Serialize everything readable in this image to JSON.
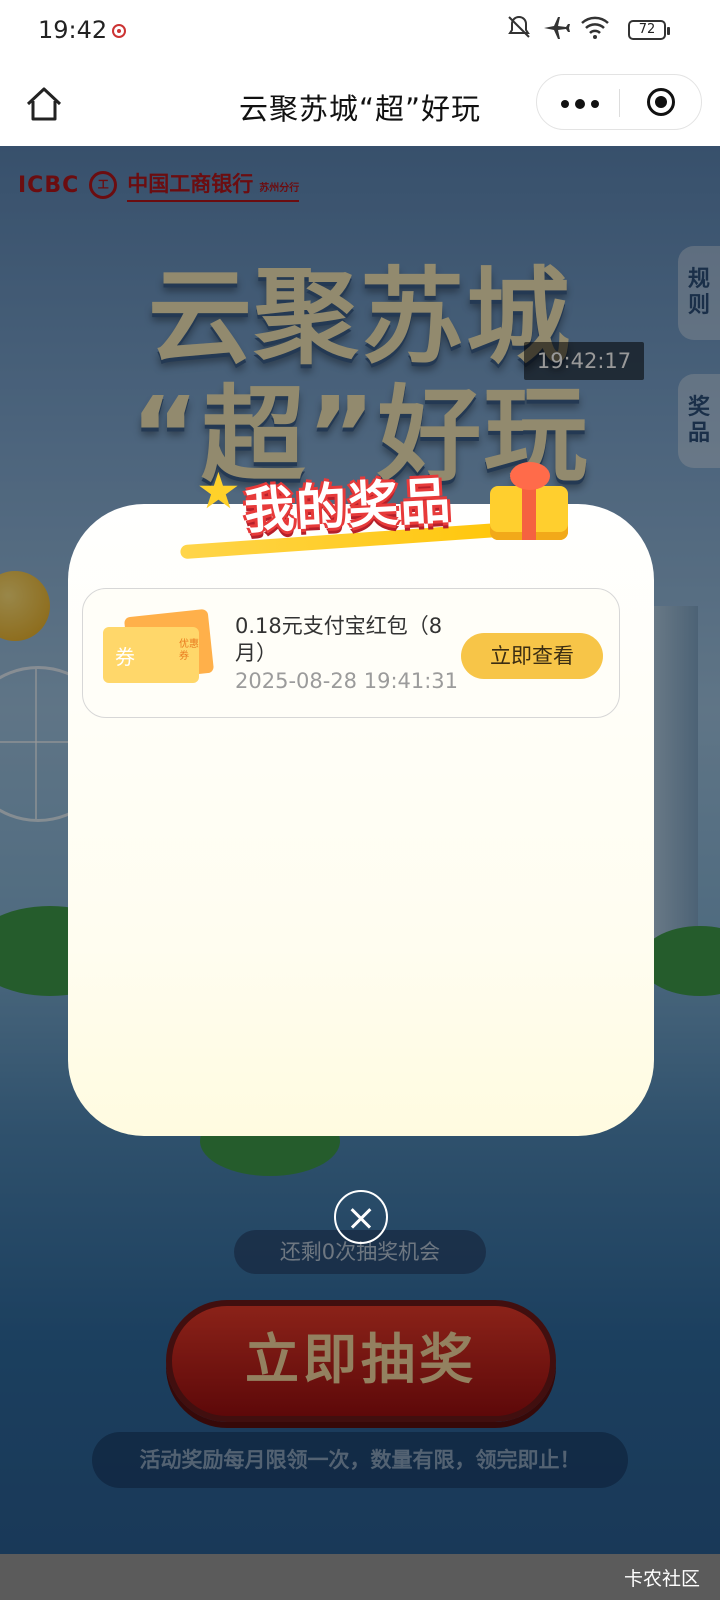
{
  "status_bar": {
    "time": "19:42",
    "battery": "72",
    "icons": [
      "recording-icon",
      "bell-off-icon",
      "airplane-icon",
      "wifi-icon",
      "battery-icon"
    ]
  },
  "nav": {
    "title": "云聚苏城“超”好玩"
  },
  "banner": {
    "bank_icbc": "ICBC",
    "bank_logo": "工",
    "bank_name": "中国工商银行",
    "bank_branch": "苏州分行",
    "hero_line1": "云聚苏城",
    "hero_line2": "“超”好玩",
    "timer": "19:42:17",
    "side_rules": "规则",
    "side_prizes": "奖品"
  },
  "page": {
    "remaining": "还剩0次抽奖机会",
    "draw_button": "立即抽奖",
    "notice": "活动奖励每月限领一次，数量有限，领完即止！"
  },
  "modal": {
    "title": "我的奖品",
    "prizes": [
      {
        "coupon_char": "券",
        "coupon_tag": "优惠券",
        "name": "0.18元支付宝红包（8月）",
        "time": "2025-08-28 19:41:31",
        "button": "立即查看"
      }
    ]
  },
  "footer": {
    "watermark": "卡农社区"
  },
  "colors": {
    "accent_yellow": "#f7c548",
    "brand_red": "#b3161c",
    "draw_red": "#e83a2a"
  }
}
